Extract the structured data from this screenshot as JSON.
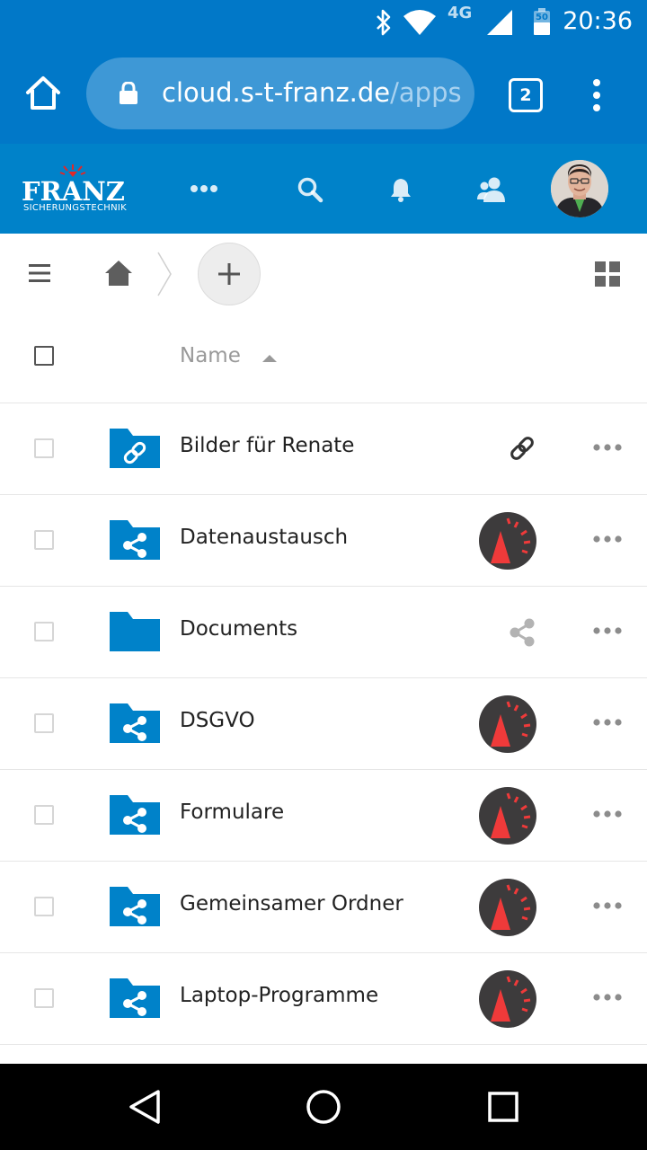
{
  "status_bar": {
    "time": "20:36",
    "network": "4G",
    "battery_level": "50",
    "icons": [
      "bluetooth-icon",
      "wifi-icon",
      "signal-icon",
      "battery-icon"
    ]
  },
  "browser": {
    "url_host": "cloud.s-t-franz.de",
    "url_path": "/apps",
    "tab_count": "2",
    "icons": [
      "home-icon",
      "lock-icon",
      "tabs-icon",
      "overflow-menu-icon"
    ]
  },
  "app_header": {
    "logo_text": "FRANZ",
    "logo_subtext": "SICHERUNGSTECHNIK",
    "icons": [
      "more-apps-icon",
      "search-icon",
      "bell-icon",
      "contacts-icon",
      "user-avatar"
    ]
  },
  "controls": {
    "icons": [
      "hamburger-icon",
      "home-icon",
      "breadcrumb-separator-icon",
      "plus-icon",
      "grid-view-icon"
    ]
  },
  "file_list": {
    "column_name": "Name",
    "sort": "ascending",
    "rows": [
      {
        "name": "Bilder für Renate",
        "folder_icon": "link-folder-icon",
        "status_icon": "link-icon"
      },
      {
        "name": "Datenaustausch",
        "folder_icon": "shared-folder-icon",
        "status_icon": "sharer-avatar"
      },
      {
        "name": "Documents",
        "folder_icon": "folder-icon",
        "status_icon": "share-icon"
      },
      {
        "name": "DSGVO",
        "folder_icon": "shared-folder-icon",
        "status_icon": "sharer-avatar"
      },
      {
        "name": "Formulare",
        "folder_icon": "shared-folder-icon",
        "status_icon": "sharer-avatar"
      },
      {
        "name": "Gemeinsamer Ordner",
        "folder_icon": "shared-folder-icon",
        "status_icon": "sharer-avatar"
      },
      {
        "name": "Laptop-Programme",
        "folder_icon": "shared-folder-icon",
        "status_icon": "sharer-avatar"
      }
    ]
  },
  "nav_bar": {
    "icons": [
      "back-icon",
      "home-circle-icon",
      "recents-icon"
    ]
  },
  "colors": {
    "brand_blue": "#0082c9",
    "browser_blue": "#0178c8",
    "avatar_red": "#ef3a3a",
    "avatar_dark": "#3d3b3c"
  }
}
